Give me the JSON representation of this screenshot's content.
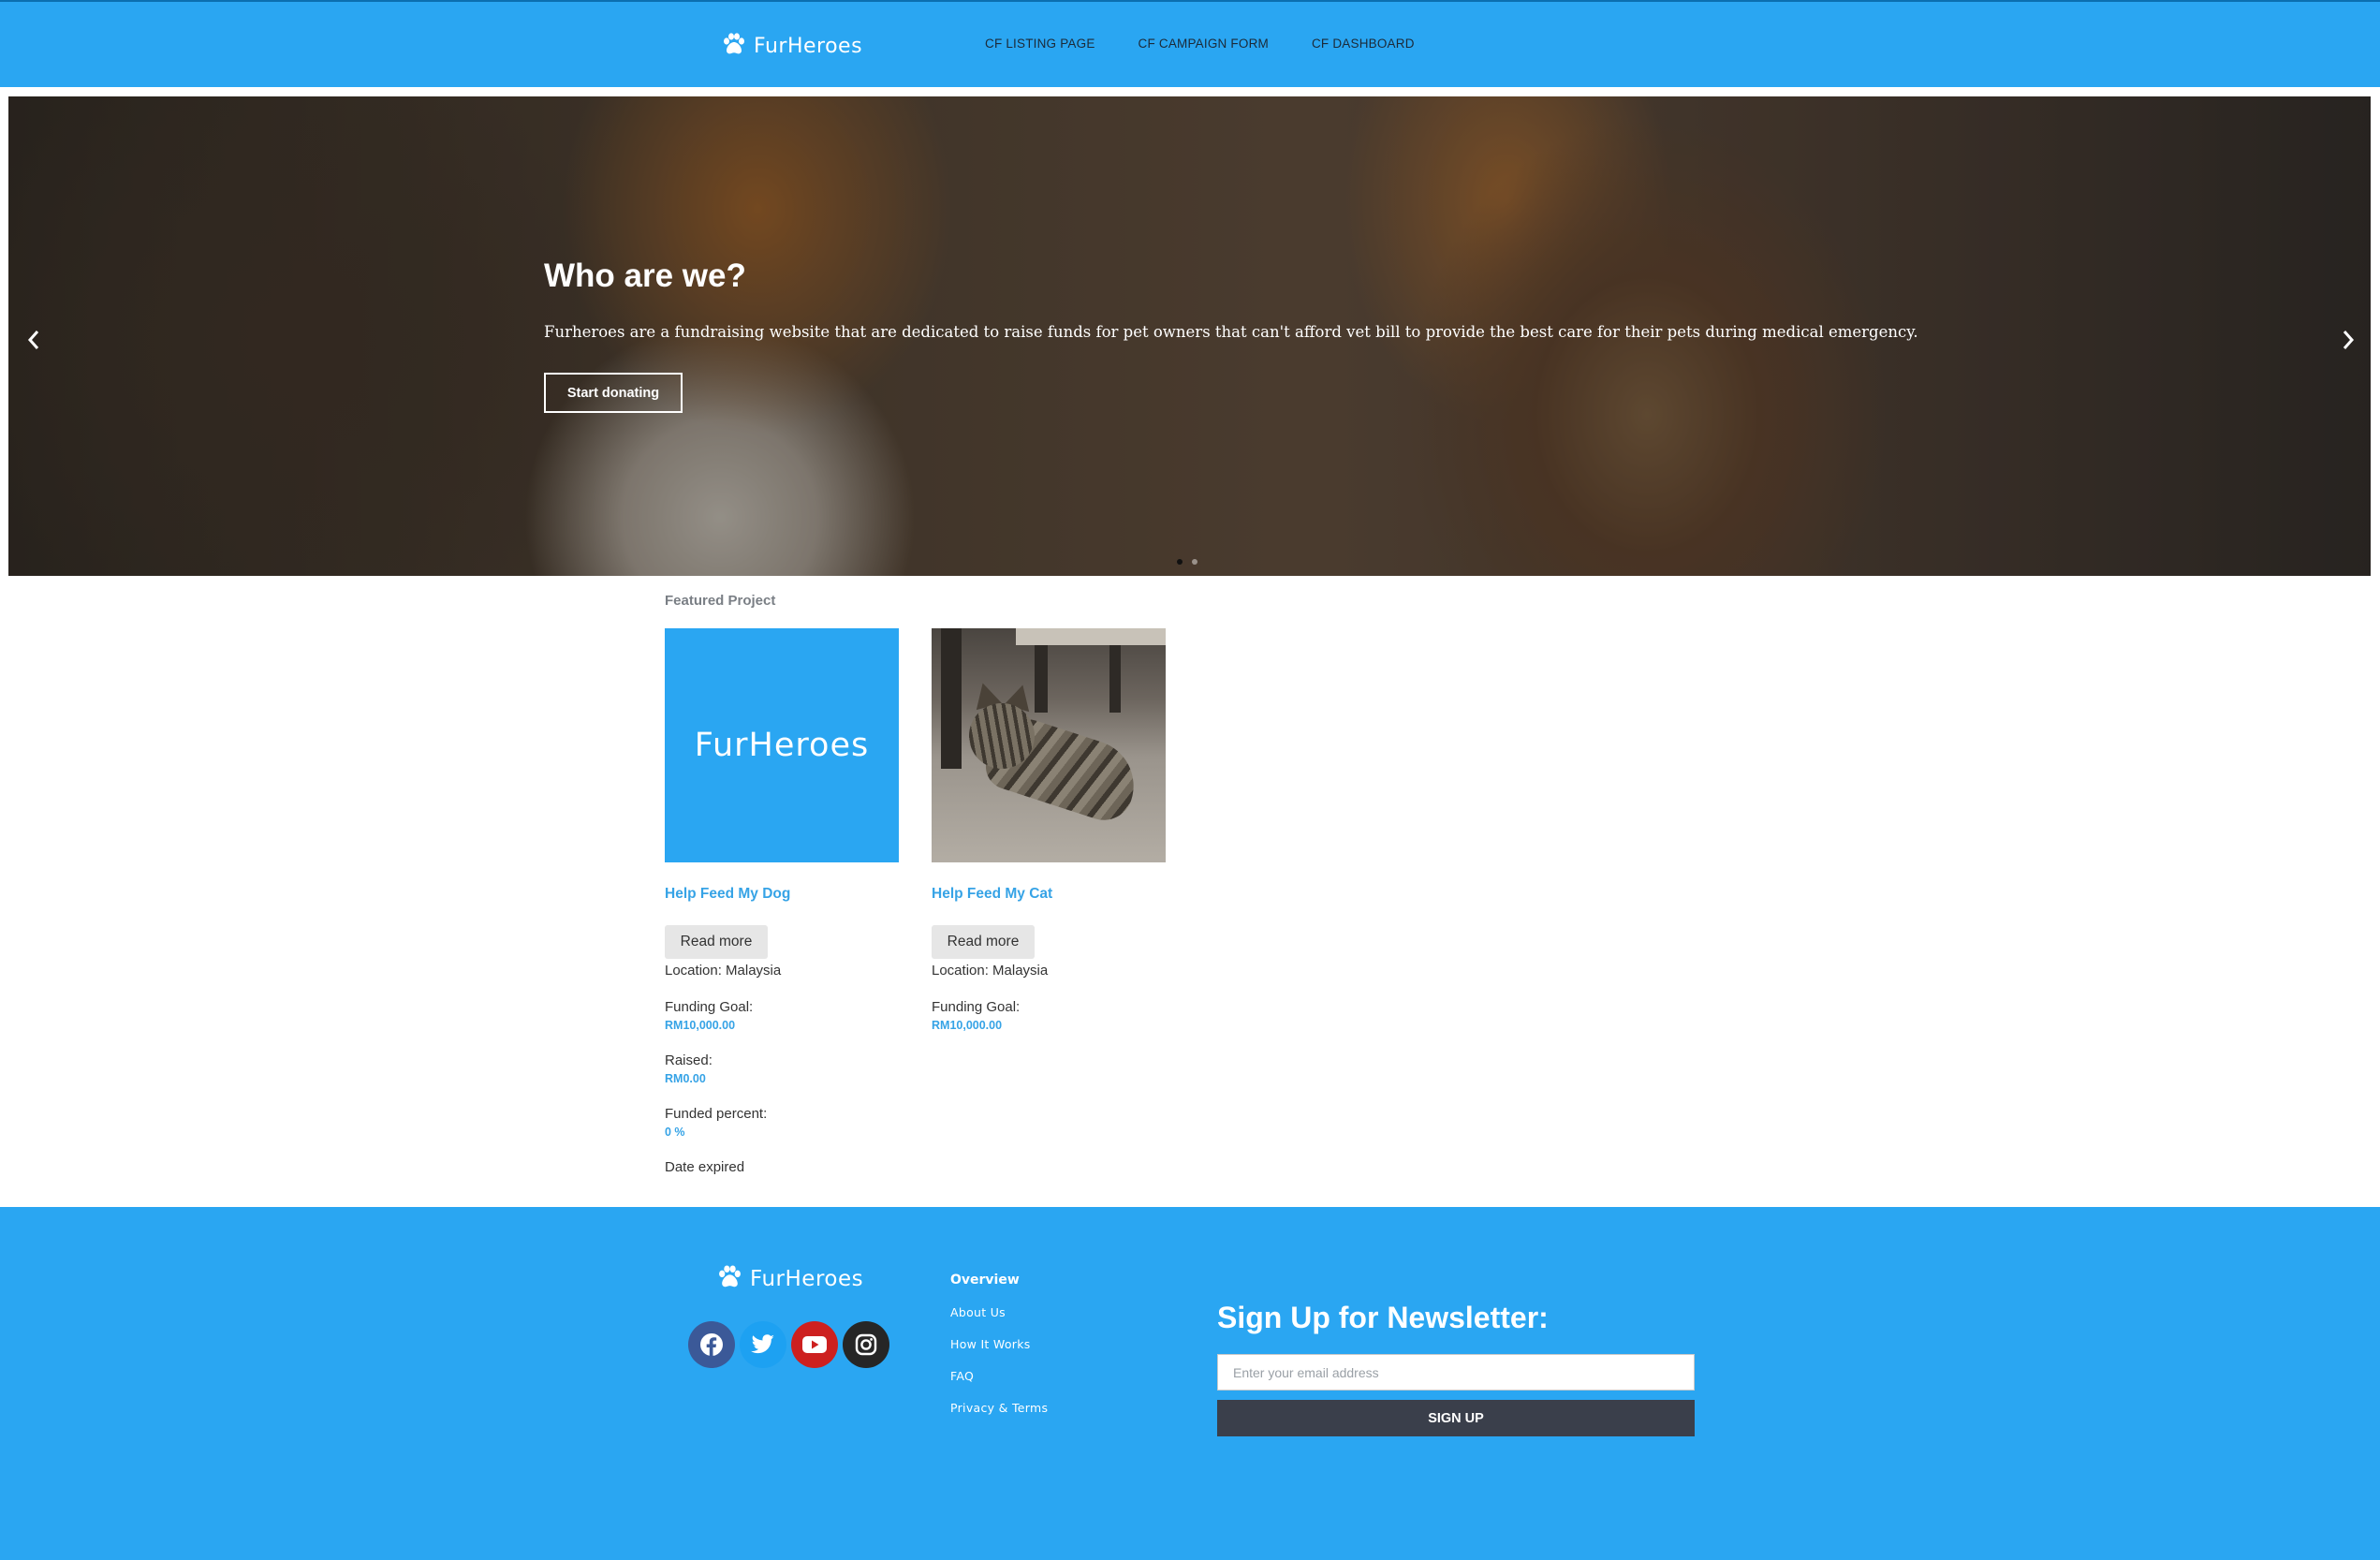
{
  "header": {
    "brand": "FurHeroes",
    "nav": [
      {
        "label": "CF LISTING PAGE"
      },
      {
        "label": "CF CAMPAIGN FORM"
      },
      {
        "label": "CF DASHBOARD"
      }
    ]
  },
  "hero": {
    "title": "Who are we?",
    "text": "Furheroes are a fundraising website that are dedicated to raise funds for pet owners that can't afford vet bill to provide the best care for their pets during medical emergency.",
    "button": "Start donating",
    "slides": 2,
    "active_slide": 1
  },
  "featured": {
    "label": "Featured Project",
    "projects": [
      {
        "thumb_text": "FurHeroes",
        "title": "Help Feed My Dog",
        "read_more": "Read more",
        "location": "Location: Malaysia",
        "goal_label": "Funding Goal:",
        "goal_value": "RM10,000.00",
        "raised_label": "Raised:",
        "raised_value": "RM0.00",
        "percent_label": "Funded percent:",
        "percent_value": "0 %",
        "date_label": "Date expired"
      },
      {
        "title": "Help Feed My Cat",
        "read_more": "Read more",
        "location": "Location: Malaysia",
        "goal_label": "Funding Goal:",
        "goal_value": "RM10,000.00"
      }
    ]
  },
  "footer": {
    "brand": "FurHeroes",
    "socials": [
      "facebook-icon",
      "twitter-icon",
      "youtube-icon",
      "instagram-icon"
    ],
    "links_heading": "Overview",
    "links": [
      "About Us",
      "How It Works",
      "FAQ",
      "Privacy & Terms"
    ],
    "newsletter": {
      "title": "Sign Up for Newsletter:",
      "placeholder": "Enter your email address",
      "button": "SIGN UP"
    }
  },
  "colors": {
    "brand_blue": "#2aa6f2",
    "link_blue": "#36a3e6",
    "dark_button": "#3a3f4b"
  }
}
